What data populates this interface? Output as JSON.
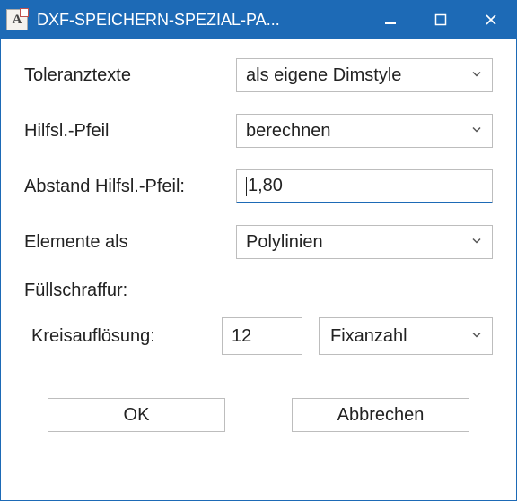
{
  "window": {
    "title": "DXF-SPEICHERN-SPEZIAL-PA...",
    "app_icon_letter": "A"
  },
  "form": {
    "toleranztexte_label": "Toleranztexte",
    "toleranztexte_value": "als eigene Dimstyle",
    "hilfsl_pfeil_label": "Hilfsl.-Pfeil",
    "hilfsl_pfeil_value": "berechnen",
    "abstand_label": "Abstand Hilfsl.-Pfeil:",
    "abstand_value": "1,80",
    "elemente_label": "Elemente als",
    "elemente_value": "Polylinien",
    "fuellschraffur_label": "Füllschraffur:",
    "kreis_label": "Kreisauflösung:",
    "kreis_value": "12",
    "kreis_mode_value": "Fixanzahl"
  },
  "buttons": {
    "ok": "OK",
    "cancel": "Abbrechen"
  }
}
